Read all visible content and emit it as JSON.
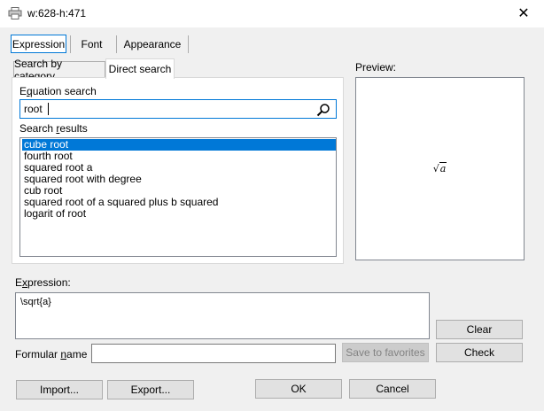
{
  "window": {
    "title": "w:628-h:471",
    "close_glyph": "✕"
  },
  "tabs": [
    {
      "label": "Expression",
      "active": true
    },
    {
      "label": "Font",
      "active": false
    },
    {
      "label": "Appearance",
      "active": false
    }
  ],
  "subtabs": [
    {
      "label": "Search by category",
      "active": false
    },
    {
      "label": "Direct search",
      "active": true
    }
  ],
  "search": {
    "label": "Equation search",
    "value": "root",
    "icon": "search-icon"
  },
  "results": {
    "label": "Search results",
    "items": [
      "cube root",
      "fourth root",
      "squared root a",
      "squared root with degree",
      "cub root",
      "squared root of a squared plus b squared",
      "logarit of root"
    ],
    "selected_index": 0
  },
  "preview": {
    "label": "Preview:",
    "radical": "√",
    "radicand": "a"
  },
  "expression": {
    "label": "Expression:",
    "value": "\\sqrt{a}"
  },
  "formular_name": {
    "label": "Formular name",
    "value": ""
  },
  "buttons": {
    "clear": "Clear",
    "save": "Save to favorites",
    "check": "Check",
    "import": "Import...",
    "export": "Export...",
    "ok": "OK",
    "cancel": "Cancel"
  },
  "colors": {
    "accent": "#0078d7",
    "background": "#f0f0f0",
    "button": "#e1e1e1"
  }
}
